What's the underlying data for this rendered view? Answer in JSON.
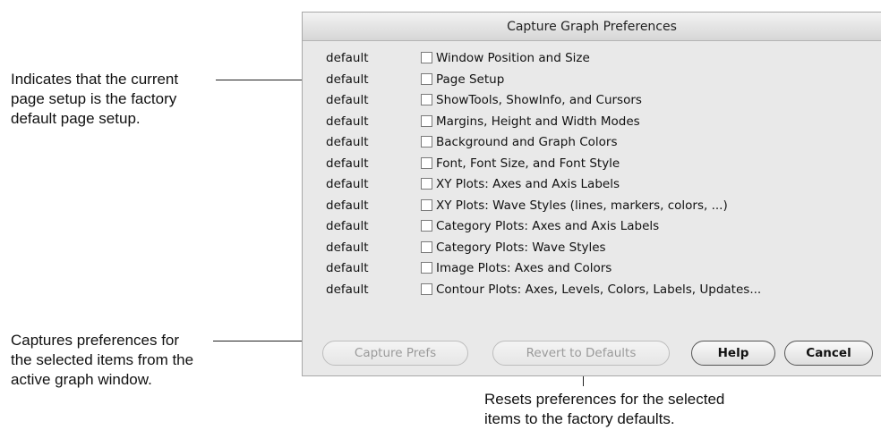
{
  "dialog": {
    "title": "Capture Graph Preferences",
    "items": [
      {
        "status": "default",
        "label": "Window Position and Size",
        "checked": false
      },
      {
        "status": "default",
        "label": "Page Setup",
        "checked": false
      },
      {
        "status": "default",
        "label": "ShowTools, ShowInfo, and Cursors",
        "checked": false
      },
      {
        "status": "default",
        "label": "Margins, Height and Width Modes",
        "checked": false
      },
      {
        "status": "default",
        "label": "Background and Graph Colors",
        "checked": false
      },
      {
        "status": "default",
        "label": "Font, Font Size, and Font Style",
        "checked": false
      },
      {
        "status": "default",
        "label": "XY Plots: Axes and Axis Labels",
        "checked": false
      },
      {
        "status": "default",
        "label": "XY Plots: Wave Styles (lines, markers, colors, ...)",
        "checked": false
      },
      {
        "status": "default",
        "label": "Category Plots: Axes and Axis Labels",
        "checked": false
      },
      {
        "status": "default",
        "label": "Category Plots: Wave Styles",
        "checked": false
      },
      {
        "status": "default",
        "label": "Image Plots: Axes and Colors",
        "checked": false
      },
      {
        "status": "default",
        "label": "Contour Plots: Axes, Levels, Colors, Labels, Updates...",
        "checked": false
      }
    ],
    "buttons": {
      "capture": "Capture Prefs",
      "revert": "Revert to Defaults",
      "help": "Help",
      "cancel": "Cancel"
    }
  },
  "callouts": {
    "page_setup": [
      "Indicates that the current",
      "page setup is the factory",
      "default page setup."
    ],
    "capture": [
      "Captures preferences for",
      "the selected items from the",
      "active graph window."
    ],
    "revert": [
      "Resets preferences for the selected",
      "items to the factory defaults."
    ]
  }
}
